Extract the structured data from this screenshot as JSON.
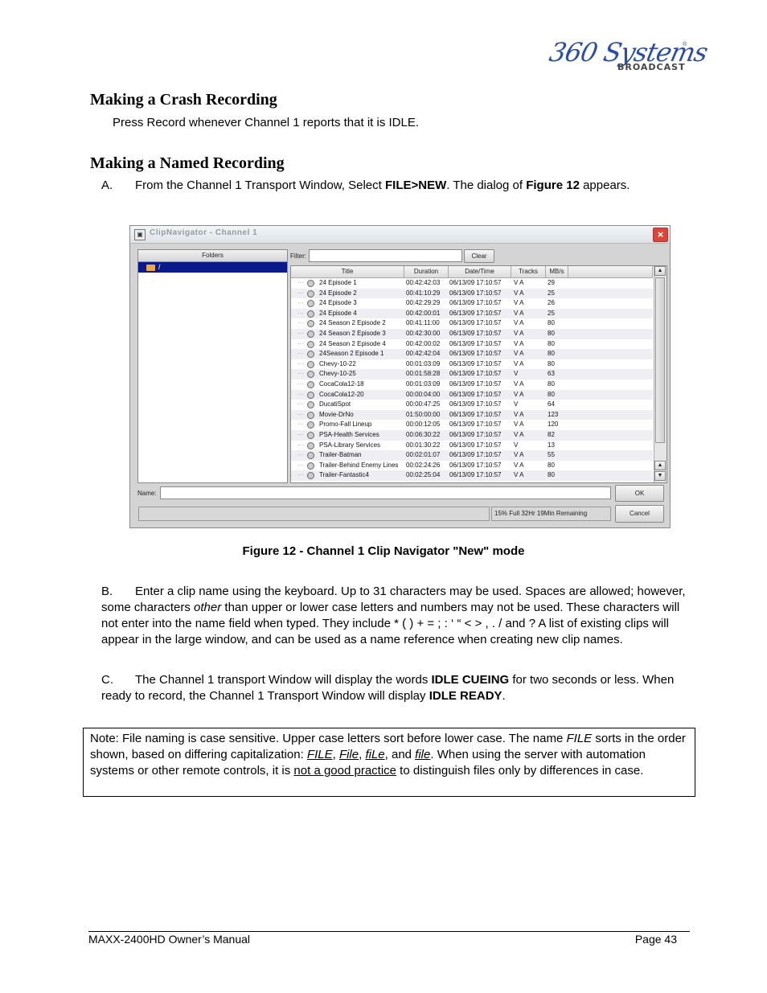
{
  "logo": {
    "script": "360 Systems",
    "sub": "BROADCAST",
    "reg": "®"
  },
  "section1": {
    "heading": "Making a Crash Recording",
    "text": "Press Record whenever Channel 1 reports that it is IDLE."
  },
  "section2": {
    "heading": "Making a Named Recording",
    "stepA": {
      "label": "A.",
      "pre": "From the Channel 1 Transport Window, Select ",
      "bold1": "FILE>NEW",
      "mid": ". The dialog of ",
      "bold2": "Figure 12",
      "post": " appears."
    }
  },
  "dialog": {
    "title": "ClipNavigator - Channel 1",
    "close_icon": "×",
    "folders_header": "Folders",
    "folder_root": "/",
    "filter_label": "Filter:",
    "filter_value": "",
    "clear_label": "Clear",
    "columns": [
      "Title",
      "Duration",
      "Date/Time",
      "Tracks",
      "MB/s"
    ],
    "rows": [
      {
        "title": "24 Episode 1",
        "duration": "00:42:42:03",
        "datetime": "06/13/09 17:10:57",
        "tracks": "V A",
        "mbs": "29"
      },
      {
        "title": "24 Episode 2",
        "duration": "00:41:10:29",
        "datetime": "06/13/09 17:10:57",
        "tracks": "V A",
        "mbs": "25"
      },
      {
        "title": "24 Episode 3",
        "duration": "00:42:29:29",
        "datetime": "06/13/09 17:10:57",
        "tracks": "V A",
        "mbs": "26"
      },
      {
        "title": "24 Episode 4",
        "duration": "00:42:00:01",
        "datetime": "06/13/09 17:10:57",
        "tracks": "V A",
        "mbs": "25"
      },
      {
        "title": "24 Season 2 Episode 2",
        "duration": "00:41:11:00",
        "datetime": "06/13/09 17:10:57",
        "tracks": "V A",
        "mbs": "80"
      },
      {
        "title": "24 Season 2 Episode 3",
        "duration": "00:42:30:00",
        "datetime": "06/13/09 17:10:57",
        "tracks": "V A",
        "mbs": "80"
      },
      {
        "title": "24 Season 2 Episode 4",
        "duration": "00:42:00:02",
        "datetime": "06/13/09 17:10:57",
        "tracks": "V A",
        "mbs": "80"
      },
      {
        "title": "24Season 2 Episode 1",
        "duration": "00:42:42:04",
        "datetime": "06/13/09 17:10:57",
        "tracks": "V A",
        "mbs": "80"
      },
      {
        "title": "Chevy-10-22",
        "duration": "00:01:03:09",
        "datetime": "06/13/09 17:10:57",
        "tracks": "V A",
        "mbs": "80"
      },
      {
        "title": "Chevy-10-25",
        "duration": "00:01:58:28",
        "datetime": "06/13/09 17:10:57",
        "tracks": "V",
        "mbs": "63"
      },
      {
        "title": "CocaCola12-18",
        "duration": "00:01:03:09",
        "datetime": "06/13/09 17:10:57",
        "tracks": "V A",
        "mbs": "80"
      },
      {
        "title": "CocaCola12-20",
        "duration": "00:00:04:00",
        "datetime": "06/13/09 17:10:57",
        "tracks": "V A",
        "mbs": "80"
      },
      {
        "title": "DucatiSpot",
        "duration": "00:00:47:25",
        "datetime": "06/13/09 17:10:57",
        "tracks": "V",
        "mbs": "64"
      },
      {
        "title": "Movie-DrNo",
        "duration": "01:50:00:00",
        "datetime": "06/13/09 17:10:57",
        "tracks": "V A",
        "mbs": "123"
      },
      {
        "title": "Promo-Fall Lineup",
        "duration": "00:00:12:05",
        "datetime": "06/13/09 17:10:57",
        "tracks": "V A",
        "mbs": "120"
      },
      {
        "title": "PSA-Health Services",
        "duration": "00:06:30:22",
        "datetime": "06/13/09 17:10:57",
        "tracks": "V A",
        "mbs": "82"
      },
      {
        "title": "PSA-Library Services",
        "duration": "00:01:30:22",
        "datetime": "06/13/09 17:10:57",
        "tracks": "V",
        "mbs": "13"
      },
      {
        "title": "Trailer-Batman",
        "duration": "00:02:01:07",
        "datetime": "06/13/09 17:10:57",
        "tracks": "V A",
        "mbs": "55"
      },
      {
        "title": "Trailer-Behind Enemy Lines",
        "duration": "00:02:24:26",
        "datetime": "06/13/09 17:10:57",
        "tracks": "V A",
        "mbs": "80"
      },
      {
        "title": "Trailer-Fantastic4",
        "duration": "00:02:25:04",
        "datetime": "06/13/09 17:10:57",
        "tracks": "V A",
        "mbs": "80"
      }
    ],
    "name_label": "Name:",
    "name_value": "",
    "ok_label": "OK",
    "cancel_label": "Cancel",
    "status": "15% Full  32Hr 19Min Remaining"
  },
  "caption": "Figure 12 - Channel 1 Clip Navigator \"New\" mode",
  "stepB": {
    "label": "B.",
    "t1": "Enter a clip name using the keyboard. Up to 31 characters may be used.  Spaces are allowed; however, some characters ",
    "em": "other",
    "t2": " than upper or lower case letters and numbers may not be used.  These characters will not enter into the name field when typed. They include * ( ) + = ; : ‘ “ < > , . / and ?  A list of existing clips will appear in the large window, and can be used as a name reference when creating new clip names."
  },
  "stepC": {
    "label": "C.",
    "t1": "The Channel 1 transport Window will display the words ",
    "b1": "IDLE CUEING",
    "t2": " for two seconds or less. When ready to record, the Channel 1 Transport Window will display ",
    "b2": "IDLE READY",
    "t3": "."
  },
  "note": {
    "t1": "Note: File naming is case sensitive.  Upper case letters sort before lower case.  The name ",
    "em1": "FILE",
    "t2": " sorts in the order shown, based on differing capitalization:  ",
    "v1": "FILE",
    "v2": "File",
    "v3": "fiLe",
    "v4": "file",
    "t3": ".  When using the server with automation systems or other remote controls, it is ",
    "u1": "not a good practice",
    "t4": " to distinguish files only by differences in case."
  },
  "footer": {
    "left": "MAXX-2400HD Owner’s Manual",
    "right": "Page 43"
  }
}
